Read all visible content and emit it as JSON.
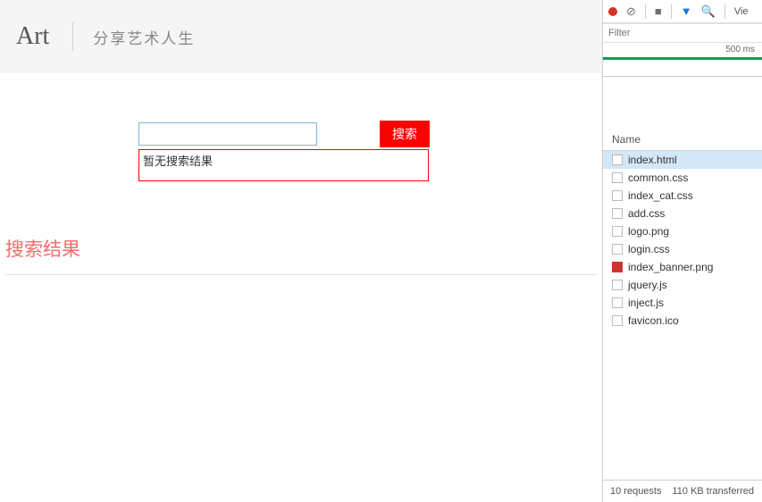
{
  "header": {
    "brand": "Art",
    "tagline": "分享艺术人生"
  },
  "search": {
    "input_value": "",
    "button_label": "搜索",
    "no_result_text": "暂无搜索结果"
  },
  "results": {
    "heading": "搜索结果"
  },
  "devtools": {
    "view_label": "Vie",
    "filter_placeholder": "Filter",
    "timeline_label": "500 ms",
    "name_header": "Name",
    "files": [
      {
        "name": "index.html",
        "type": "doc",
        "selected": true
      },
      {
        "name": "common.css",
        "type": "doc",
        "selected": false
      },
      {
        "name": "index_cat.css",
        "type": "doc",
        "selected": false
      },
      {
        "name": "add.css",
        "type": "doc",
        "selected": false
      },
      {
        "name": "logo.png",
        "type": "doc",
        "selected": false
      },
      {
        "name": "login.css",
        "type": "doc",
        "selected": false
      },
      {
        "name": "index_banner.png",
        "type": "img",
        "selected": false
      },
      {
        "name": "jquery.js",
        "type": "doc",
        "selected": false
      },
      {
        "name": "inject.js",
        "type": "doc",
        "selected": false
      },
      {
        "name": "favicon.ico",
        "type": "doc",
        "selected": false
      }
    ],
    "status": {
      "requests": "10 requests",
      "transferred": "110 KB transferred"
    }
  }
}
